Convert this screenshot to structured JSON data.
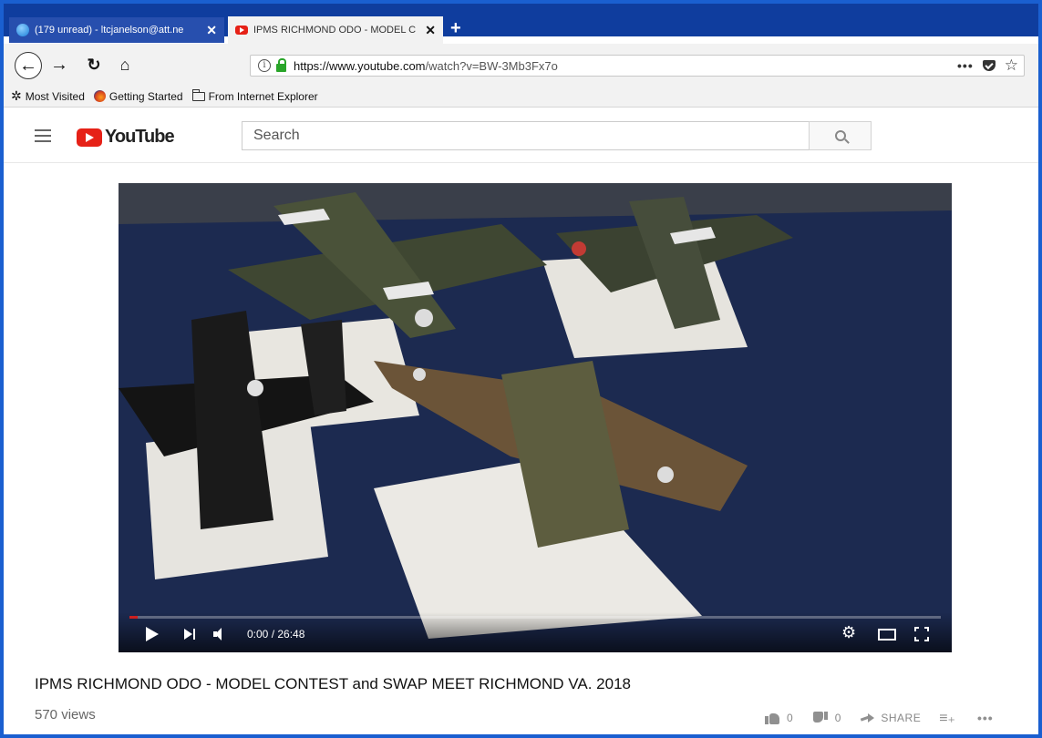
{
  "browser": {
    "tabs": [
      {
        "label": "(179 unread) - ltcjanelson@att.ne",
        "close": "✕"
      },
      {
        "label": "IPMS RICHMOND ODO - MODEL C",
        "close": "✕"
      }
    ],
    "new_tab": "+",
    "url_host": "https://www.youtube.com",
    "url_path": "/watch?v=BW-3Mb3Fx7o",
    "bookmarks": [
      {
        "label": "Most Visited"
      },
      {
        "label": "Getting Started"
      },
      {
        "label": "From Internet Explorer"
      }
    ]
  },
  "youtube": {
    "logo_text": "YouTube",
    "search_placeholder": "Search"
  },
  "video": {
    "progress": 0.01,
    "time": "0:00 / 26:48",
    "title": "IPMS RICHMOND ODO - MODEL CONTEST and SWAP MEET RICHMOND VA. 2018",
    "views": "570 views",
    "likes": "0",
    "dislikes": "0",
    "share_label": "SHARE"
  },
  "colors": {
    "accent": "#e62117",
    "tabstrip": "#0f3d9e",
    "frame": "#1a5fd0"
  },
  "icons": [
    "globe-icon",
    "youtube-favicon-icon",
    "back-arrow-icon",
    "forward-arrow-icon",
    "reload-icon",
    "home-icon",
    "info-icon",
    "lock-icon",
    "ellipsis-icon",
    "pocket-icon",
    "star-icon",
    "gear-icon",
    "firefox-icon",
    "folder-icon",
    "menu-icon",
    "search-icon",
    "play-icon",
    "next-icon",
    "volume-icon",
    "settings-icon",
    "theater-icon",
    "fullscreen-icon",
    "like-icon",
    "dislike-icon",
    "share-icon",
    "add-to-playlist-icon",
    "more-icon"
  ]
}
